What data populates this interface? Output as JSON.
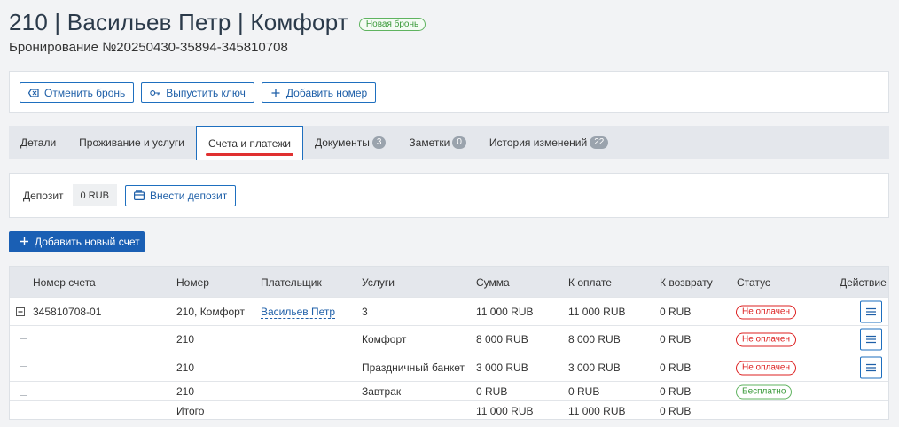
{
  "header": {
    "title": "210 | Васильев Петр | Комфорт",
    "status_badge": "Новая бронь",
    "subtitle": "Бронирование №20250430-35894-345810708"
  },
  "toolbar": {
    "cancel_label": "Отменить бронь",
    "issue_key_label": "Выпустить ключ",
    "add_room_label": "Добавить номер"
  },
  "tabs": [
    {
      "label": "Детали",
      "count": null
    },
    {
      "label": "Проживание и услуги",
      "count": null
    },
    {
      "label": "Счета и платежи",
      "count": null,
      "active": true
    },
    {
      "label": "Документы",
      "count": "3"
    },
    {
      "label": "Заметки",
      "count": "0"
    },
    {
      "label": "История изменений",
      "count": "22"
    }
  ],
  "deposit": {
    "label": "Депозит",
    "value": "0 RUB",
    "button_label": "Внести депозит"
  },
  "add_invoice_label": "Добавить новый счет",
  "table": {
    "columns": [
      "Номер счета",
      "Номер",
      "Плательщик",
      "Услуги",
      "Сумма",
      "К оплате",
      "К возврату",
      "Статус",
      "Действие"
    ],
    "rows": [
      {
        "invoice": "345810708-01",
        "room": "210, Комфорт",
        "payer": "Васильев Петр",
        "service": "3",
        "sum": "11 000 RUB",
        "to_pay": "11 000 RUB",
        "refund": "0 RUB",
        "status": "Не оплачен",
        "status_type": "red",
        "action": true
      },
      {
        "invoice": "",
        "room": "210",
        "payer": "",
        "service": "Комфорт",
        "sum": "8 000 RUB",
        "to_pay": "8 000 RUB",
        "refund": "0 RUB",
        "status": "Не оплачен",
        "status_type": "red",
        "action": true
      },
      {
        "invoice": "",
        "room": "210",
        "payer": "",
        "service": "Праздничный банкет",
        "sum": "3 000 RUB",
        "to_pay": "3 000 RUB",
        "refund": "0 RUB",
        "status": "Не оплачен",
        "status_type": "red",
        "action": true
      },
      {
        "invoice": "",
        "room": "210",
        "payer": "",
        "service": "Завтрак",
        "sum": "0 RUB",
        "to_pay": "0 RUB",
        "refund": "0 RUB",
        "status": "Бесплатно",
        "status_type": "green",
        "action": false
      }
    ],
    "total": {
      "label": "Итого",
      "sum": "11 000 RUB",
      "to_pay": "11 000 RUB",
      "refund": "0 RUB"
    }
  }
}
